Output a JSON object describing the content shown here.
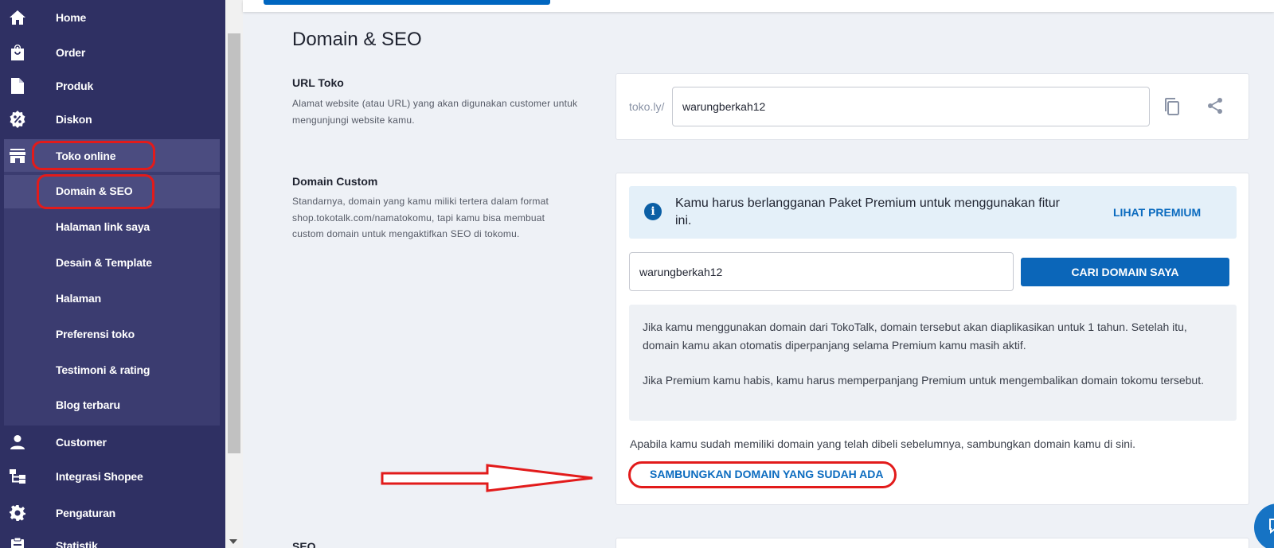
{
  "sidebar": {
    "items": [
      {
        "label": "Home",
        "icon": "home-icon"
      },
      {
        "label": "Order",
        "icon": "shopping-bag-icon"
      },
      {
        "label": "Produk",
        "icon": "document-icon"
      },
      {
        "label": "Diskon",
        "icon": "discount-icon"
      },
      {
        "label": "Toko online",
        "icon": "store-icon"
      },
      {
        "label": "Customer",
        "icon": "person-icon"
      },
      {
        "label": "Integrasi Shopee",
        "icon": "integration-icon"
      },
      {
        "label": "Pengaturan",
        "icon": "gear-icon"
      },
      {
        "label": "Statistik",
        "icon": "clipboard-icon"
      }
    ],
    "sub_items": [
      {
        "label": "Domain & SEO"
      },
      {
        "label": "Halaman link saya"
      },
      {
        "label": "Desain & Template"
      },
      {
        "label": "Halaman"
      },
      {
        "label": "Preferensi toko"
      },
      {
        "label": "Testimoni & rating"
      },
      {
        "label": "Blog terbaru"
      }
    ]
  },
  "main": {
    "title": "Domain & SEO",
    "url_section": {
      "title": "URL Toko",
      "description": "Alamat website (atau URL) yang akan digunakan customer untuk mengunjungi website kamu.",
      "prefix": "toko.ly/",
      "value": "warungberkah12"
    },
    "domain_section": {
      "title": "Domain Custom",
      "description": "Standarnya, domain yang kamu miliki tertera dalam format shop.tokotalk.com/namatokomu, tapi kamu bisa membuat custom domain untuk mengaktifkan SEO di tokomu.",
      "info_text": "Kamu harus berlangganan Paket Premium untuk menggunakan fitur ini.",
      "info_link": "LIHAT PREMIUM",
      "domain_input": "warungberkah12",
      "search_button": "CARI DOMAIN SAYA",
      "note_1": "Jika kamu menggunakan domain dari TokoTalk, domain tersebut akan diaplikasikan untuk 1 tahun. Setelah itu, domain kamu akan otomatis diperpanjang selama Premium kamu masih aktif.",
      "note_2": "Jika Premium kamu habis, kamu harus memperpanjang Premium untuk mengembalikan domain tokomu tersebut.",
      "connect_text": "Apabila kamu sudah memiliki domain yang telah dibeli sebelumnya, sambungkan domain kamu di sini.",
      "connect_link": "SAMBUNGKAN DOMAIN YANG SUDAH ADA"
    },
    "seo_section": {
      "title": "SEO"
    }
  },
  "colors": {
    "sidebar": "#2f3063",
    "primary": "#0b66b9",
    "annotation": "#e21b1b"
  }
}
